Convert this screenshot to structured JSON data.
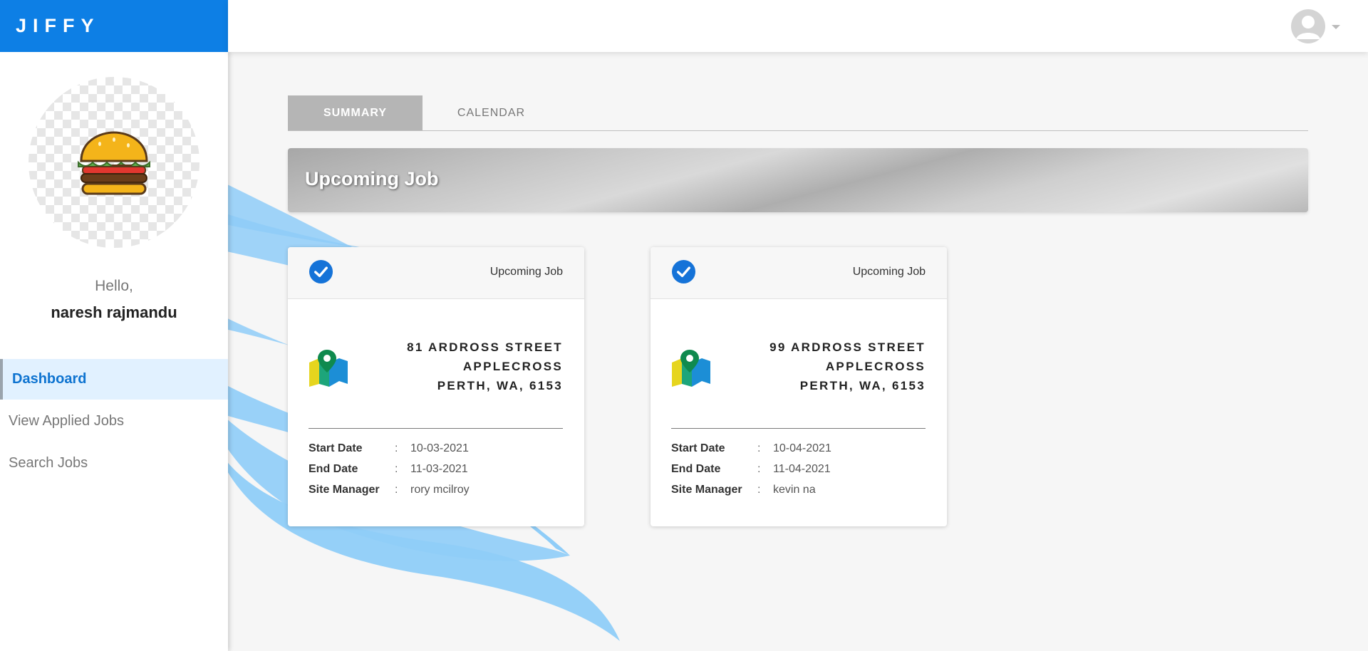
{
  "app": {
    "brand": "JIFFY"
  },
  "sidebar": {
    "greeting": "Hello,",
    "username": "naresh rajmandu",
    "items": [
      {
        "label": "Dashboard",
        "active": true
      },
      {
        "label": "View Applied Jobs",
        "active": false
      },
      {
        "label": "Search Jobs",
        "active": false
      }
    ]
  },
  "header": {
    "profile_icon": "user-avatar-icon"
  },
  "main": {
    "tabs": [
      {
        "label": "SUMMARY",
        "active": true
      },
      {
        "label": "CALENDAR",
        "active": false
      }
    ],
    "banner_title": "Upcoming Job",
    "jobs": [
      {
        "status": "Upcoming Job",
        "address_line1": "81 ARDROSS STREET",
        "address_line2": "APPLECROSS",
        "address_line3": "PERTH, WA, 6153",
        "start_label": "Start Date",
        "start_date": "10-03-2021",
        "end_label": "End Date",
        "end_date": "11-03-2021",
        "manager_label": "Site Manager",
        "manager": "rory mcilroy",
        "separator": ":"
      },
      {
        "status": "Upcoming Job",
        "address_line1": "99 ARDROSS STREET",
        "address_line2": "APPLECROSS",
        "address_line3": "PERTH, WA, 6153",
        "start_label": "Start Date",
        "start_date": "10-04-2021",
        "end_label": "End Date",
        "end_date": "11-04-2021",
        "manager_label": "Site Manager",
        "manager": "kevin na",
        "separator": ":"
      }
    ]
  },
  "colors": {
    "brand": "#0d7fe5",
    "accent": "#1573d8",
    "active_nav_bg": "#dceeff",
    "swoosh": "#8fcdf8"
  }
}
